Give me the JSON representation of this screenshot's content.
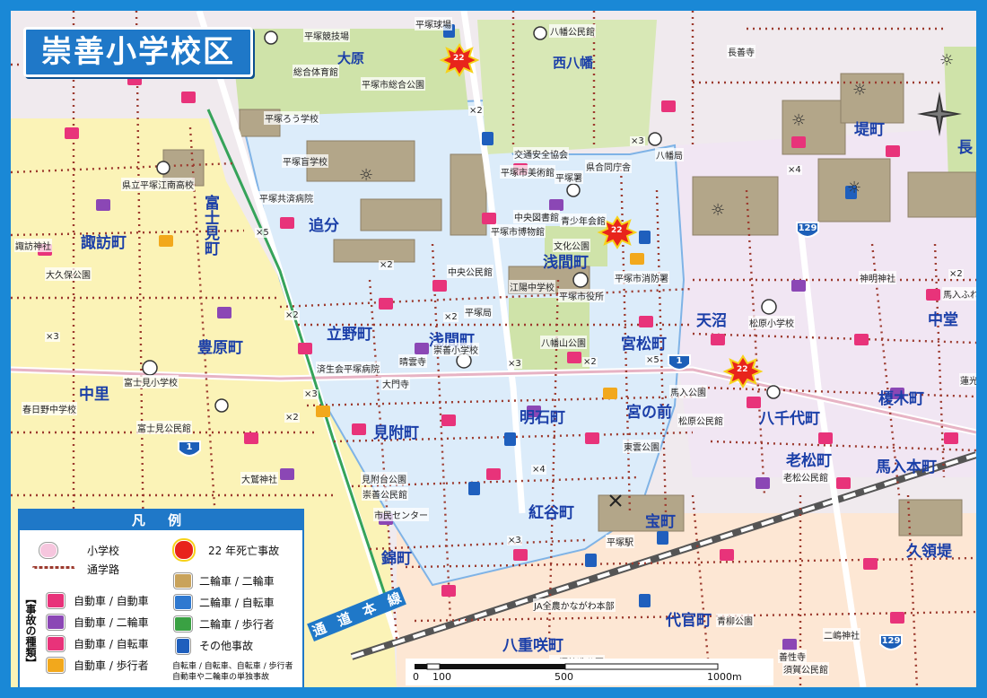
{
  "title": "崇善小学校区",
  "districts": [
    {
      "key": "ohara",
      "text": "大原"
    },
    {
      "key": "nishi_hachiman",
      "text": "西八幡"
    },
    {
      "key": "tsutsumicho",
      "text": "堤町"
    },
    {
      "key": "naga",
      "text": "長"
    },
    {
      "key": "oiwake",
      "text": "追分"
    },
    {
      "key": "suwacho",
      "text": "諏訪町"
    },
    {
      "key": "fujimicho",
      "text": "富士見町"
    },
    {
      "key": "sengencho",
      "text": "浅間町"
    },
    {
      "key": "tatenocho",
      "text": "立野町"
    },
    {
      "key": "sengencho2",
      "text": "浅間町"
    },
    {
      "key": "toyoharacho",
      "text": "豊原町"
    },
    {
      "key": "tenuma",
      "text": "天沼"
    },
    {
      "key": "nakado",
      "text": "中堂"
    },
    {
      "key": "miyamatsucho",
      "text": "宮松町"
    },
    {
      "key": "nakazato",
      "text": "中里"
    },
    {
      "key": "akashicho",
      "text": "明石町"
    },
    {
      "key": "miyanomae",
      "text": "宮の前"
    },
    {
      "key": "hachisendaicho",
      "text": "八千代町"
    },
    {
      "key": "enokicho",
      "text": "榎木町"
    },
    {
      "key": "mitsukecho",
      "text": "見附町"
    },
    {
      "key": "oimatsucho",
      "text": "老松町"
    },
    {
      "key": "umairihoncho",
      "text": "馬入本町"
    },
    {
      "key": "benikayacho",
      "text": "紅谷町"
    },
    {
      "key": "takaracho",
      "text": "宝町"
    },
    {
      "key": "nishikicho",
      "text": "錦町"
    },
    {
      "key": "kugedo",
      "text": "久領堤"
    },
    {
      "key": "daikancho",
      "text": "代官町"
    },
    {
      "key": "yaesakicho",
      "text": "八重咲町"
    },
    {
      "key": "road",
      "text": "通　道　本　線"
    }
  ],
  "places": [
    {
      "key": "a1",
      "text": "平塚競技場"
    },
    {
      "key": "a2",
      "text": "平塚球場"
    },
    {
      "key": "a3",
      "text": "八幡公民館"
    },
    {
      "key": "a4",
      "text": "総合体育館"
    },
    {
      "key": "a5",
      "text": "平塚市総合公園"
    },
    {
      "key": "a6",
      "text": "長善寺"
    },
    {
      "key": "a7",
      "text": "平塚ろう学校"
    },
    {
      "key": "a8",
      "text": "交通安全協会"
    },
    {
      "key": "a9",
      "text": "八幡局"
    },
    {
      "key": "a10",
      "text": "平塚市美術館"
    },
    {
      "key": "a11",
      "text": "県合同庁舎"
    },
    {
      "key": "a12",
      "text": "平塚盲学校"
    },
    {
      "key": "a13",
      "text": "平塚署"
    },
    {
      "key": "a14",
      "text": "県立平塚江南高校"
    },
    {
      "key": "a15",
      "text": "平塚共済病院"
    },
    {
      "key": "a16",
      "text": "中央図書館"
    },
    {
      "key": "a17",
      "text": "青少年会館"
    },
    {
      "key": "a18",
      "text": "平塚市博物館"
    },
    {
      "key": "a19",
      "text": "文化公園"
    },
    {
      "key": "a20",
      "text": "諏訪神社"
    },
    {
      "key": "a21",
      "text": "大久保公園"
    },
    {
      "key": "a22",
      "text": "中央公民館"
    },
    {
      "key": "a23",
      "text": "平塚市消防署"
    },
    {
      "key": "a24",
      "text": "神明神社"
    },
    {
      "key": "a25",
      "text": "江陽中学校"
    },
    {
      "key": "a26",
      "text": "平塚市役所"
    },
    {
      "key": "a27",
      "text": "平塚局"
    },
    {
      "key": "a28",
      "text": "松原小学校"
    },
    {
      "key": "a29",
      "text": "馬入ふれ"
    },
    {
      "key": "a30",
      "text": "崇善小学校"
    },
    {
      "key": "a31",
      "text": "晴雲寺"
    },
    {
      "key": "a32",
      "text": "八幡山公園"
    },
    {
      "key": "a33",
      "text": "済生会平塚病院"
    },
    {
      "key": "a34",
      "text": "大門寺"
    },
    {
      "key": "a35",
      "text": "富士見小学校"
    },
    {
      "key": "a36",
      "text": "春日野中学校"
    },
    {
      "key": "a37",
      "text": "富士見公民館"
    },
    {
      "key": "a38",
      "text": "馬入公園"
    },
    {
      "key": "a39",
      "text": "松原公民館"
    },
    {
      "key": "a40",
      "text": "蓮光"
    },
    {
      "key": "a41",
      "text": "東雲公園"
    },
    {
      "key": "a42",
      "text": "老松公民館"
    },
    {
      "key": "a43",
      "text": "見附台公園"
    },
    {
      "key": "a44",
      "text": "崇善公民館"
    },
    {
      "key": "a45",
      "text": "市民センター"
    },
    {
      "key": "a46",
      "text": "大鷲神社"
    },
    {
      "key": "a47",
      "text": "平塚駅"
    },
    {
      "key": "a48",
      "text": "JA全農かながわ本部"
    },
    {
      "key": "a49",
      "text": "青柳公園"
    },
    {
      "key": "a50",
      "text": "二嶋神社"
    },
    {
      "key": "a51",
      "text": "善性寺"
    },
    {
      "key": "a52",
      "text": "須賀公民館"
    },
    {
      "key": "a53",
      "text": "平塚鋳造公園"
    }
  ],
  "routes": [
    {
      "key": "r129a",
      "text": "129"
    },
    {
      "key": "r1a",
      "text": "1"
    },
    {
      "key": "r1b",
      "text": "1"
    },
    {
      "key": "r129b",
      "text": "129"
    }
  ],
  "fatal_marker": "22",
  "multipliers": [
    "×2",
    "×3",
    "×4",
    "×5",
    "×2",
    "×3",
    "×2",
    "×2",
    "×3",
    "×2",
    "×5",
    "×3",
    "×2",
    "×4",
    "×2",
    "×3"
  ],
  "legend": {
    "heading": "凡 例",
    "items": [
      {
        "key": "school",
        "icon": "school-icon",
        "text": "小学校"
      },
      {
        "key": "route",
        "icon": "school-route-line",
        "text": "通学路"
      },
      {
        "key": "fatal",
        "icon": "fatal-accident-icon",
        "text": "22 年死亡事故"
      },
      {
        "key": "car_car",
        "icon": "car-car-icon",
        "text": "自動車 / 自動車"
      },
      {
        "key": "car_moto",
        "icon": "car-motorcycle-icon",
        "text": "自動車 / 二輪車"
      },
      {
        "key": "car_bike",
        "icon": "car-bicycle-icon",
        "text": "自動車 / 自転車"
      },
      {
        "key": "car_ped",
        "icon": "car-pedestrian-icon",
        "text": "自動車 / 歩行者"
      },
      {
        "key": "moto_moto",
        "icon": "motorcycle-motorcycle-icon",
        "text": "二輪車 / 二輪車"
      },
      {
        "key": "moto_bike",
        "icon": "motorcycle-bicycle-icon",
        "text": "二輪車 / 自転車"
      },
      {
        "key": "moto_ped",
        "icon": "motorcycle-pedestrian-icon",
        "text": "二輪車 / 歩行者"
      },
      {
        "key": "other",
        "icon": "other-accident-icon",
        "text": "その他事故"
      }
    ],
    "vertical_label": "【事故の種類】",
    "note1": "自転車 / 自転車、自転車 / 歩行者",
    "note2": "自動車や二輪車の単独事故"
  },
  "scale": {
    "labels": [
      "0",
      "100",
      "500",
      "1000m"
    ]
  },
  "colors": {
    "frame": "#1a88d6",
    "school_district": "#dcecfa",
    "west_area": "#fbf3b7",
    "east_area": "#f1e6f3",
    "south_area": "#fde8d6",
    "park": "#cfe3a9",
    "building": "#a89b82",
    "accident_pink": "#e8337a",
    "accident_yellow": "#f2a81c",
    "accident_purple": "#8b47b5",
    "accident_blue": "#2f79d0",
    "accident_green": "#3aa143",
    "route_dots": "#9c3a2e"
  }
}
